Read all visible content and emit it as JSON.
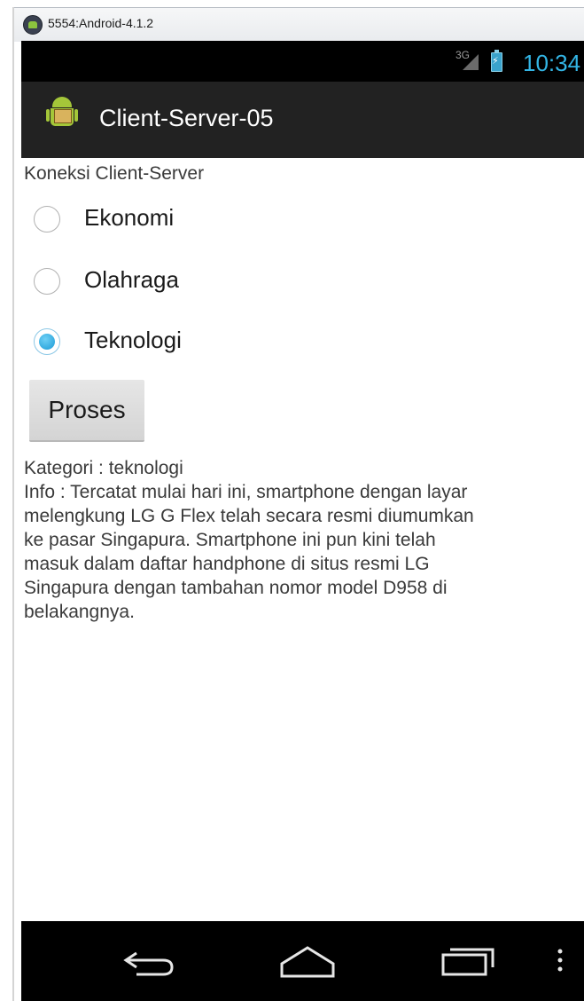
{
  "window": {
    "title": "5554:Android-4.1.2",
    "icon": "android-emulator-icon"
  },
  "status_bar": {
    "network": "3G",
    "time": "10:34",
    "accent_color": "#33b5e5",
    "icons": [
      "signal-icon",
      "battery-charging-icon"
    ]
  },
  "action_bar": {
    "title": "Client-Server-05",
    "icon": "android-app-icon"
  },
  "content": {
    "heading": "Koneksi Client-Server",
    "radio_options": [
      {
        "label": "Ekonomi",
        "checked": false
      },
      {
        "label": "Olahraga",
        "checked": false
      },
      {
        "label": "Teknologi",
        "checked": true
      }
    ],
    "button_label": "Proses",
    "result_lines": [
      "Kategori : teknologi",
      "Info : Tercatat mulai hari ini, smartphone dengan layar",
      "melengkung LG G Flex telah secara resmi diumumkan",
      "ke pasar Singapura. Smartphone ini pun kini telah",
      "masuk dalam daftar handphone di situs resmi LG",
      "Singapura dengan tambahan nomor model D958 di",
      "belakangnya."
    ]
  },
  "nav_bar": {
    "icons": [
      "back-icon",
      "home-icon",
      "recent-apps-icon",
      "menu-icon"
    ]
  }
}
